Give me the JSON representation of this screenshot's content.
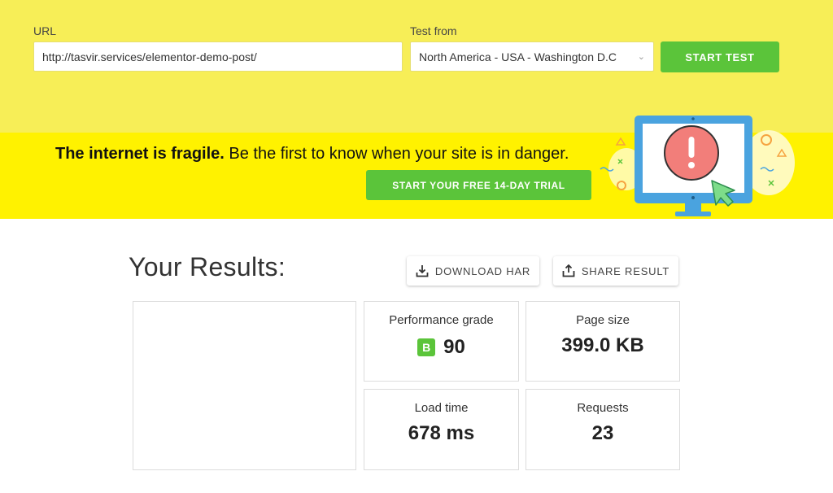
{
  "form": {
    "url_label": "URL",
    "url_value": "http://tasvir.services/elementor-demo-post/",
    "test_from_label": "Test from",
    "test_from_value": "North America - USA - Washington D.C",
    "start_test_label": "START TEST"
  },
  "banner": {
    "bold_text": "The internet is fragile.",
    "text": " Be the first to know when your site is in danger.",
    "trial_button_label": "START YOUR FREE 14-DAY TRIAL"
  },
  "results": {
    "title": "Your Results:",
    "download_har_label": "DOWNLOAD HAR",
    "share_result_label": "SHARE RESULT",
    "performance_grade_label": "Performance grade",
    "performance_grade_letter": "B",
    "performance_grade_value": "90",
    "page_size_label": "Page size",
    "page_size_value": "399.0 KB",
    "load_time_label": "Load time",
    "load_time_value": "678 ms",
    "requests_label": "Requests",
    "requests_value": "23"
  },
  "colors": {
    "top_bg": "#f7ee57",
    "banner_bg": "#fff200",
    "accent_green": "#5bc43a"
  }
}
